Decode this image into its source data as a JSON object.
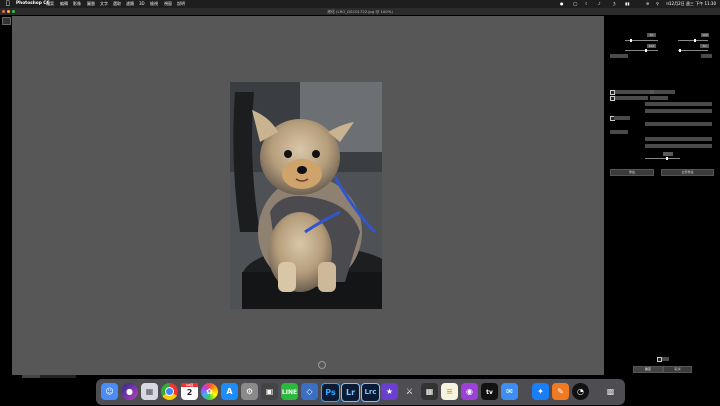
{
  "menubar": {
    "app_name": "Photoshop CC",
    "items": [
      "檔案",
      "編輯",
      "影像",
      "圖層",
      "文字",
      "選取",
      "濾鏡",
      "3D",
      "檢視",
      "視窗",
      "說明"
    ],
    "clock": "12月2日 週三 下午 11:30"
  },
  "window": {
    "title": "液化 (LRO_DSC01722.jpg @ 100%)"
  },
  "panel": {
    "brush_chip_1": "50",
    "brush_chip_2": "100",
    "brush_chip_3": "100",
    "brush_chip_4": "50",
    "slider_1_value": 0.15,
    "slider_2_value": 0.52,
    "slider_3_value": 0.62,
    "slider_4_value": 0.45,
    "slider_5_value": 0.6,
    "buttons": {
      "reset": "重設",
      "all_reset": "全部重設",
      "ok": "確定",
      "cancel": "取消"
    }
  },
  "colors": {
    "canvas_bg": "#575757",
    "panel_bg": "#000000",
    "menubar_bg": "#1e1e1e"
  },
  "dock": {
    "icons": [
      "finder-icon",
      "siri-icon",
      "launchpad-icon",
      "chrome-icon",
      "calendar-icon",
      "photos-icon",
      "app-store-icon",
      "system-preferences-icon",
      "screenshot-icon",
      "line-icon",
      "preview-icon",
      "photoshop-icon",
      "lightroom-icon",
      "lightroom-classic-icon",
      "imovie-icon",
      "dictionary-icon",
      "calculator-icon",
      "notes-icon",
      "podcasts-icon",
      "apple-tv-icon",
      "mail-icon",
      "safari-icon",
      "pages-icon",
      "activity-icon",
      "trash-icon"
    ],
    "calendar_month": "12月",
    "calendar_day": "2",
    "photoshop_label": "Ps",
    "lightroom_label": "Lr",
    "lightroom_classic_label": "Lrc",
    "tv_label": "tv"
  }
}
